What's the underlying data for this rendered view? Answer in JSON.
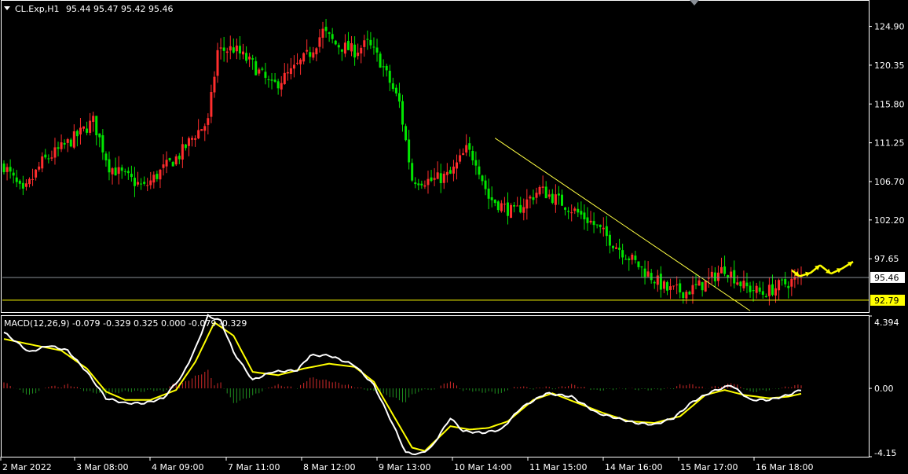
{
  "window": {
    "symbol_title": "CL.Exp,H1",
    "ohlc_text": "95.44 95.47 95.42 95.46",
    "dropdown_icon": "triangle-down-icon"
  },
  "chart_data": [
    {
      "type": "candlestick",
      "panel": "price",
      "price_axis_ticks": [
        "124.90",
        "120.35",
        "115.80",
        "111.25",
        "106.70",
        "102.20",
        "97.65"
      ],
      "ylim": [
        91.4,
        127.9
      ],
      "time_axis_labels": [
        "2 Mar 2022",
        "3 Mar 08:00",
        "4 Mar 09:00",
        "7 Mar 11:00",
        "8 Mar 12:00",
        "9 Mar 13:00",
        "10 Mar 14:00",
        "11 Mar 15:00",
        "14 Mar 16:00",
        "15 Mar 17:00",
        "16 Mar 18:00"
      ],
      "anchors": [
        [
          0,
          108.6
        ],
        [
          6,
          105.2
        ],
        [
          12,
          109.0
        ],
        [
          18,
          110.6
        ],
        [
          24,
          112.4
        ],
        [
          28,
          113.8
        ],
        [
          33,
          108.5
        ],
        [
          38,
          107.3
        ],
        [
          44,
          106.0
        ],
        [
          50,
          108.2
        ],
        [
          55,
          109.8
        ],
        [
          60,
          112.3
        ],
        [
          64,
          113.7
        ],
        [
          67,
          122.0
        ],
        [
          72,
          122.3
        ],
        [
          78,
          120.4
        ],
        [
          84,
          117.8
        ],
        [
          90,
          119.5
        ],
        [
          96,
          121.8
        ],
        [
          100,
          124.3
        ],
        [
          104,
          122.8
        ],
        [
          110,
          122.0
        ],
        [
          114,
          122.9
        ],
        [
          118,
          120.8
        ],
        [
          124,
          115.9
        ],
        [
          128,
          107.0
        ],
        [
          134,
          106.8
        ],
        [
          140,
          107.5
        ],
        [
          145,
          110.4
        ],
        [
          148,
          109.3
        ],
        [
          152,
          104.8
        ],
        [
          160,
          103.0
        ],
        [
          168,
          105.8
        ],
        [
          176,
          104.0
        ],
        [
          184,
          102.0
        ],
        [
          192,
          99.2
        ],
        [
          200,
          96.5
        ],
        [
          208,
          94.0
        ],
        [
          214,
          93.8
        ],
        [
          220,
          94.8
        ],
        [
          226,
          96.6
        ],
        [
          232,
          94.4
        ],
        [
          238,
          93.6
        ],
        [
          244,
          94.6
        ],
        [
          250,
          95.46
        ]
      ],
      "current_price": "95.46",
      "horizontal_level": "92.79",
      "colors": {
        "bull": "#ff2d2d",
        "bear": "#00e600",
        "trendline": "#ffff44",
        "level": "#ffff00",
        "current_line": "#8a8f96",
        "grid_frame": "#ffffff"
      }
    },
    {
      "type": "macd",
      "panel": "indicator",
      "title": "MACD(12,26,9) -0.079 -0.329 0.325 0.000 -0.079 -0.329",
      "axis_ticks": [
        "4.394",
        "0.00",
        "-4.15"
      ],
      "ylim": [
        -4.15,
        4.394
      ],
      "macd_anchors": [
        [
          0,
          3.4
        ],
        [
          8,
          2.2
        ],
        [
          14,
          2.6
        ],
        [
          20,
          2.3
        ],
        [
          26,
          1.0
        ],
        [
          32,
          -0.6
        ],
        [
          38,
          -0.9
        ],
        [
          44,
          -0.9
        ],
        [
          50,
          -0.6
        ],
        [
          56,
          0.8
        ],
        [
          60,
          2.4
        ],
        [
          64,
          4.4
        ],
        [
          68,
          4.1
        ],
        [
          72,
          2.2
        ],
        [
          78,
          0.5
        ],
        [
          84,
          1.0
        ],
        [
          92,
          1.1
        ],
        [
          96,
          2.0
        ],
        [
          102,
          2.0
        ],
        [
          110,
          1.4
        ],
        [
          116,
          0.2
        ],
        [
          122,
          -2.2
        ],
        [
          126,
          -3.9
        ],
        [
          130,
          -4.0
        ],
        [
          134,
          -3.6
        ],
        [
          140,
          -1.8
        ],
        [
          144,
          -2.6
        ],
        [
          150,
          -2.7
        ],
        [
          156,
          -2.5
        ],
        [
          162,
          -1.2
        ],
        [
          170,
          -0.3
        ],
        [
          178,
          -0.5
        ],
        [
          186,
          -1.5
        ],
        [
          192,
          -1.8
        ],
        [
          198,
          -2.1
        ],
        [
          204,
          -2.2
        ],
        [
          210,
          -1.8
        ],
        [
          216,
          -0.8
        ],
        [
          222,
          -0.2
        ],
        [
          228,
          0.2
        ],
        [
          234,
          -0.7
        ],
        [
          240,
          -0.7
        ],
        [
          246,
          -0.4
        ],
        [
          250,
          -0.079
        ]
      ],
      "signal_anchors": [
        [
          0,
          3.0
        ],
        [
          10,
          2.6
        ],
        [
          18,
          2.3
        ],
        [
          26,
          1.2
        ],
        [
          32,
          -0.2
        ],
        [
          38,
          -0.7
        ],
        [
          46,
          -0.7
        ],
        [
          54,
          -0.1
        ],
        [
          60,
          1.6
        ],
        [
          66,
          4.0
        ],
        [
          72,
          3.2
        ],
        [
          78,
          1.0
        ],
        [
          86,
          0.8
        ],
        [
          94,
          1.2
        ],
        [
          102,
          1.5
        ],
        [
          110,
          1.3
        ],
        [
          116,
          0.4
        ],
        [
          122,
          -1.6
        ],
        [
          128,
          -3.6
        ],
        [
          132,
          -3.8
        ],
        [
          140,
          -2.3
        ],
        [
          146,
          -2.5
        ],
        [
          152,
          -2.4
        ],
        [
          158,
          -2.0
        ],
        [
          166,
          -0.7
        ],
        [
          172,
          -0.3
        ],
        [
          180,
          -0.9
        ],
        [
          188,
          -1.5
        ],
        [
          196,
          -2.0
        ],
        [
          204,
          -2.1
        ],
        [
          212,
          -1.7
        ],
        [
          220,
          -0.4
        ],
        [
          226,
          -0.1
        ],
        [
          232,
          -0.4
        ],
        [
          240,
          -0.6
        ],
        [
          246,
          -0.5
        ],
        [
          250,
          -0.329
        ]
      ],
      "colors": {
        "macd_line": "#ffffff",
        "signal_line": "#ffff00",
        "hist_pos": "#d22a2a",
        "hist_neg": "#1f8f1f"
      }
    }
  ],
  "annotations": {
    "forecast_arrows": [
      [
        1008,
        96.3
      ],
      [
        1018,
        95.6
      ],
      [
        1032,
        96.0
      ],
      [
        1044,
        96.9
      ],
      [
        1058,
        95.9
      ],
      [
        1072,
        96.5
      ],
      [
        1086,
        97.3
      ]
    ],
    "arrow_color": "#ffff00"
  }
}
